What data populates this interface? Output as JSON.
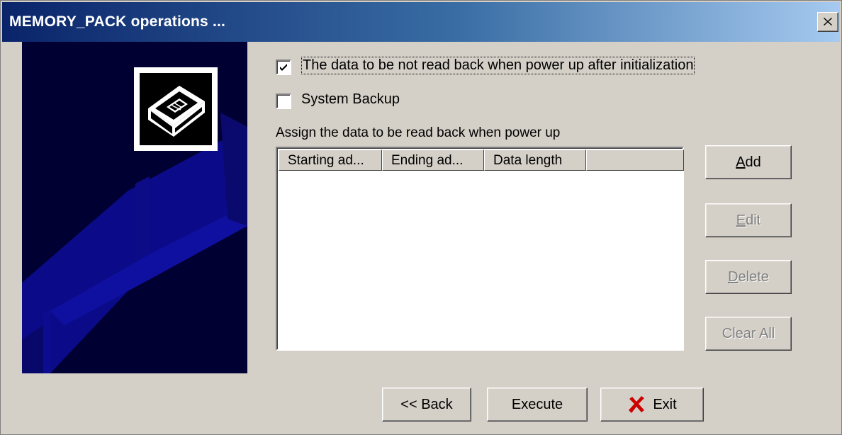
{
  "window": {
    "title": "MEMORY_PACK operations ..."
  },
  "options": {
    "no_read_back": {
      "label": "The data to be not read back when power up after initialization",
      "checked": true
    },
    "system_backup": {
      "label": "System Backup",
      "checked": false
    }
  },
  "assign_label": "Assign the data to be read back when power up",
  "table": {
    "columns": [
      "Starting ad...",
      "Ending ad...",
      "Data length"
    ],
    "rows": []
  },
  "side_buttons": {
    "add": {
      "first": "A",
      "rest": "dd",
      "enabled": true
    },
    "edit": {
      "first": "E",
      "rest": "dit",
      "enabled": false
    },
    "delete": {
      "first": "D",
      "rest": "elete",
      "enabled": false
    },
    "clear_all": {
      "label": "Clear All",
      "enabled": false
    }
  },
  "bottom_buttons": {
    "back": "<< Back",
    "execute": "Execute",
    "exit": "Exit"
  },
  "icons": {
    "close": "close-icon",
    "check": "check-icon",
    "exit": "red-x-icon",
    "memory_pack": "memory-pack-icon"
  },
  "colors": {
    "dialog_bg": "#d4d0c8",
    "title_start": "#0a246a",
    "title_end": "#a6caf0",
    "side_image_bg": "#000033",
    "exit_icon": "#cc0000"
  }
}
